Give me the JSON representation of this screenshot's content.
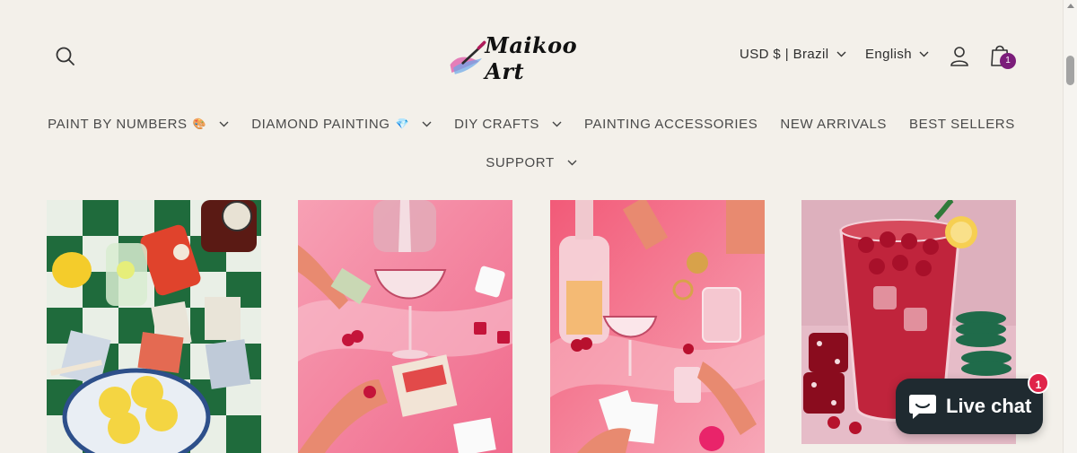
{
  "header": {
    "logo_text": "Maikoo Art",
    "currency": "USD $ | Brazil",
    "language": "English",
    "cart_count": "1"
  },
  "nav": {
    "row1": [
      {
        "label": "PAINT BY NUMBERS",
        "emoji": "🎨",
        "has_dropdown": true
      },
      {
        "label": "DIAMOND PAINTING",
        "emoji": "💎",
        "has_dropdown": true
      },
      {
        "label": "DIY CRAFTS",
        "emoji": "",
        "has_dropdown": true
      },
      {
        "label": "PAINTING ACCESSORIES",
        "emoji": "",
        "has_dropdown": false
      },
      {
        "label": "NEW ARRIVALS",
        "emoji": "",
        "has_dropdown": false
      },
      {
        "label": "BEST SELLERS",
        "emoji": "",
        "has_dropdown": false
      }
    ],
    "row2": [
      {
        "label": "SUPPORT",
        "emoji": "",
        "has_dropdown": true
      }
    ]
  },
  "products": [
    {
      "name": "green-checkered-table-lemons-painting"
    },
    {
      "name": "pink-cocktail-cards-painting"
    },
    {
      "name": "pink-bottles-cherries-painting"
    },
    {
      "name": "cherry-drink-dice-painting"
    }
  ],
  "live_chat": {
    "label": "Live chat",
    "badge": "1"
  },
  "colors": {
    "background": "#f3f0ea",
    "cart_badge": "#7b1d7a",
    "chat_bg": "#1f2a30",
    "chat_badge": "#e0244a"
  },
  "icons": [
    "search-icon",
    "account-icon",
    "cart-icon",
    "chevron-down-icon",
    "chat-bubble-icon"
  ]
}
